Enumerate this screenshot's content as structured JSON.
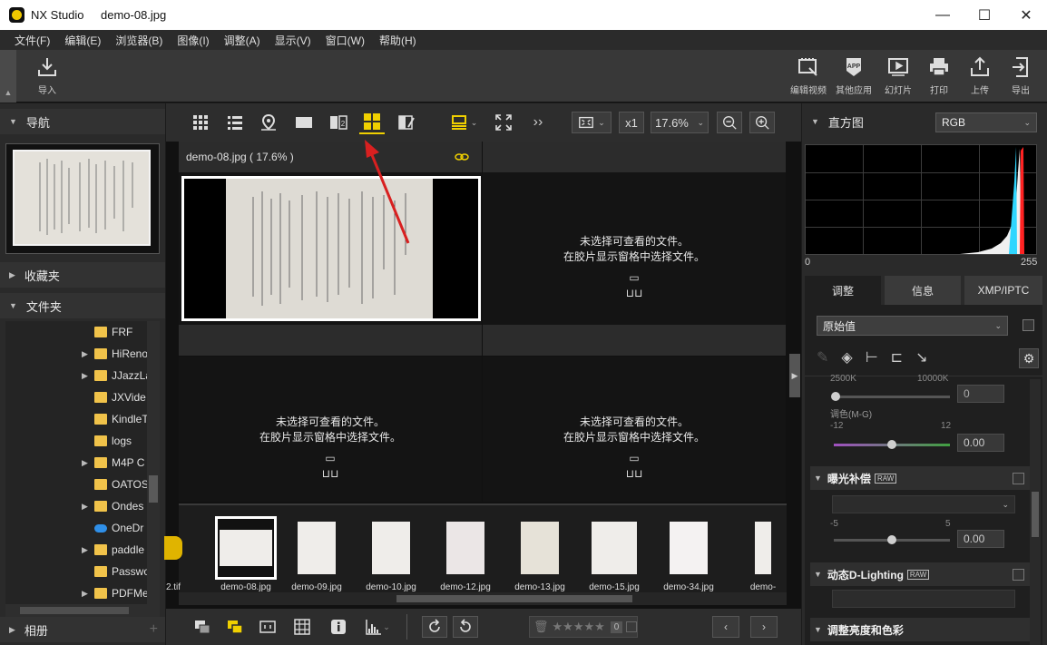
{
  "window": {
    "app_name": "NX Studio",
    "file_name": "demo-08.jpg",
    "minimize": "—",
    "maximize": "☐",
    "close": "✕"
  },
  "menu": [
    "文件(F)",
    "编辑(E)",
    "浏览器(B)",
    "图像(I)",
    "调整(A)",
    "显示(V)",
    "窗口(W)",
    "帮助(H)"
  ],
  "toolbar": {
    "import": "导入",
    "right": [
      "编辑视频",
      "其他应用",
      "幻灯片",
      "打印",
      "上传",
      "导出"
    ]
  },
  "left": {
    "navigation": "导航",
    "favorites": "收藏夹",
    "folders": "文件夹",
    "albums": "相册",
    "folder_items": [
      "FRF",
      "HiReno",
      "JJazzLa",
      "JXVide",
      "KindleT",
      "logs",
      "M4P C",
      "OATOS",
      "Ondes",
      "OneDr",
      "paddle",
      "Passwo",
      "PDFMe"
    ]
  },
  "viewer": {
    "zoom_multiplier": "x1",
    "zoom_value": "17.6%",
    "pane1_title": "demo-08.jpg ( 17.6% )",
    "empty_line1": "未选择可查看的文件。",
    "empty_line2": "在胶片显示窗格中选择文件。"
  },
  "filmstrip": [
    {
      "name": "2.tif",
      "selected": false
    },
    {
      "name": "demo-08.jpg",
      "selected": true
    },
    {
      "name": "demo-09.jpg",
      "selected": false
    },
    {
      "name": "demo-10.jpg",
      "selected": false
    },
    {
      "name": "demo-12.jpg",
      "selected": false
    },
    {
      "name": "demo-13.jpg",
      "selected": false
    },
    {
      "name": "demo-15.jpg",
      "selected": false
    },
    {
      "name": "demo-34.jpg",
      "selected": false
    },
    {
      "name": "demo-",
      "selected": false
    }
  ],
  "bottombar": {
    "rating_count": "0"
  },
  "right": {
    "histogram": "直方图",
    "channel": "RGB",
    "hist_min": "0",
    "hist_max": "255",
    "tabs": [
      "调整",
      "信息",
      "XMP/IPTC"
    ],
    "preset": "原始值",
    "wb_min": "2500K",
    "wb_max": "10000K",
    "wb_value": "0",
    "tint_label": "调色(M-G)",
    "tint_min": "-12",
    "tint_max": "12",
    "tint_value": "0.00",
    "exposure": "曝光补偿",
    "exp_min": "-5",
    "exp_max": "5",
    "exp_value": "0.00",
    "adl": "动态D-Lighting",
    "brightness": "调整亮度和色彩",
    "raw_badge": "RAW"
  },
  "colors": {
    "accent": "#f0d000",
    "annotation_arrow": "#d82020"
  }
}
